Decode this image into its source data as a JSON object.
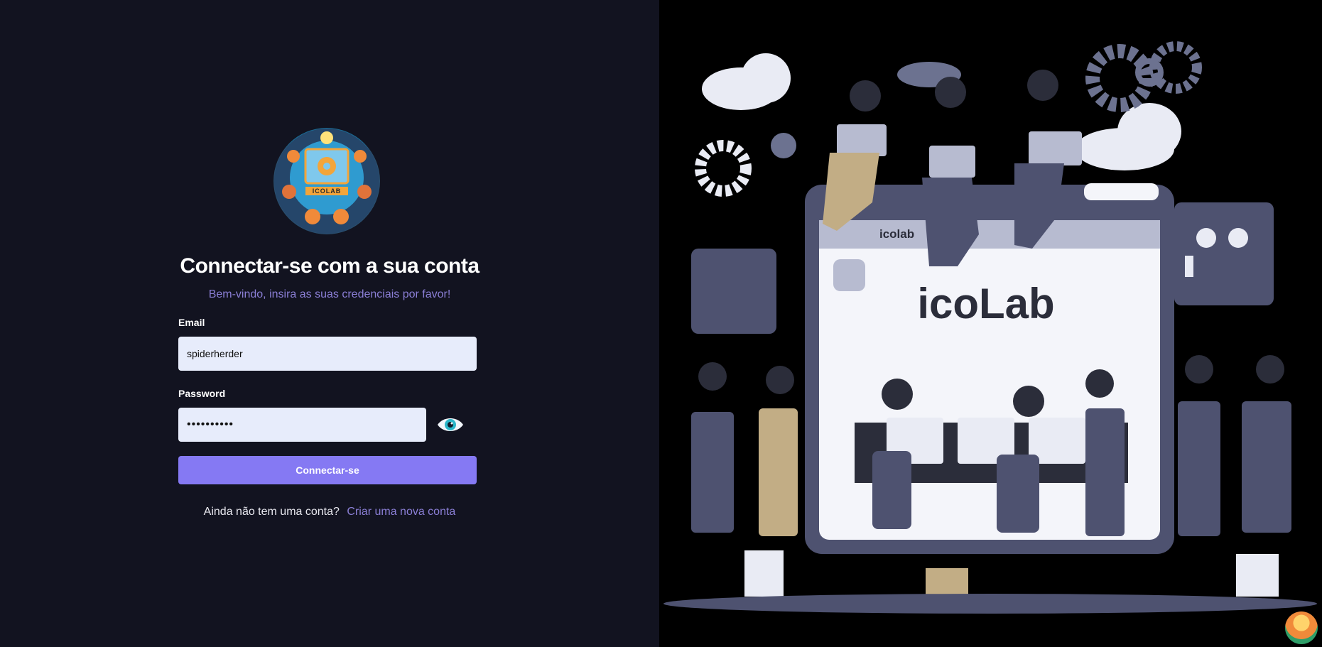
{
  "brand": {
    "logo_text": "ICOLAB"
  },
  "login": {
    "title": "Connectar-se com a sua conta",
    "subtitle": "Bem-vindo, insira as suas credenciais por favor!",
    "email_label": "Email",
    "email_value": "spiderherder",
    "password_label": "Password",
    "password_value": "••••••••••",
    "submit_label": "Connectar-se",
    "signup_question": "Ainda não tem uma conta?",
    "signup_link": "Criar uma nova conta"
  },
  "illustration": {
    "screen_title": "icoLab",
    "screen_tab": "icolab"
  },
  "icons": {
    "eye": "eye-icon"
  },
  "colors": {
    "background": "#121320",
    "accent": "#8579f3",
    "link": "#8b7fd6",
    "input_bg": "#e7ecfb"
  }
}
